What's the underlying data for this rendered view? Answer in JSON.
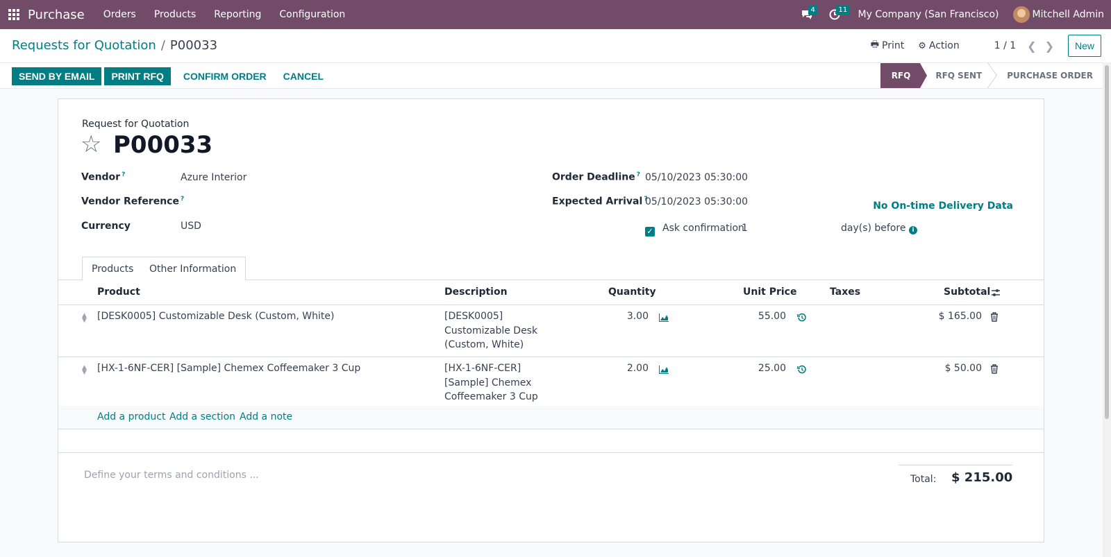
{
  "navbar": {
    "app_name": "Purchase",
    "menu": [
      "Orders",
      "Products",
      "Reporting",
      "Configuration"
    ],
    "messages_count": "4",
    "activities_count": "11",
    "company": "My Company (San Francisco)",
    "user": "Mitchell Admin"
  },
  "control": {
    "breadcrumb_parent": "Requests for Quotation",
    "breadcrumb_sep": "/",
    "breadcrumb_current": "P00033",
    "print_label": "Print",
    "action_label": "Action",
    "pager": "1 / 1",
    "new_label": "New"
  },
  "statusbar": {
    "buttons": [
      "SEND BY EMAIL",
      "PRINT RFQ"
    ],
    "link_buttons": [
      "CONFIRM ORDER",
      "CANCEL"
    ],
    "stages": [
      "RFQ",
      "RFQ SENT",
      "PURCHASE ORDER"
    ],
    "active_stage": "RFQ"
  },
  "form": {
    "doc_type": "Request for Quotation",
    "name": "P00033",
    "vendor_label": "Vendor",
    "vendor_value": "Azure Interior",
    "vendor_ref_label": "Vendor Reference",
    "currency_label": "Currency",
    "currency_value": "USD",
    "order_deadline_label": "Order Deadline",
    "order_deadline_value": "05/10/2023 05:30:00",
    "expected_arrival_label": "Expected Arrival",
    "expected_arrival_value": "05/10/2023 05:30:00",
    "ontime_label": "No On-time Delivery Data",
    "ask_confirmation_label": "Ask confirmation",
    "ask_confirmation_days": "1",
    "days_before_label": "day(s) before",
    "help_marker": "?"
  },
  "tabs": [
    "Products",
    "Other Information"
  ],
  "table": {
    "headers": {
      "product": "Product",
      "description": "Description",
      "quantity": "Quantity",
      "unit_price": "Unit Price",
      "taxes": "Taxes",
      "subtotal": "Subtotal"
    },
    "rows": [
      {
        "product": "[DESK0005] Customizable Desk (Custom, White)",
        "description": "[DESK0005] Customizable Desk (Custom, White)",
        "quantity": "3.00",
        "unit_price": "55.00",
        "taxes": "",
        "subtotal": "$ 165.00"
      },
      {
        "product": "[HX-1-6NF-CER] [Sample] Chemex Coffeemaker 3 Cup",
        "description": "[HX-1-6NF-CER] [Sample] Chemex Coffeemaker 3 Cup",
        "quantity": "2.00",
        "unit_price": "25.00",
        "taxes": "",
        "subtotal": "$ 50.00"
      }
    ],
    "add_links": [
      "Add a product",
      "Add a section",
      "Add a note"
    ]
  },
  "footer": {
    "terms_placeholder": "Define your terms and conditions ...",
    "total_label": "Total:",
    "total_value": "$ 215.00"
  },
  "colors": {
    "brand": "#714b67",
    "accent": "#017e84"
  }
}
